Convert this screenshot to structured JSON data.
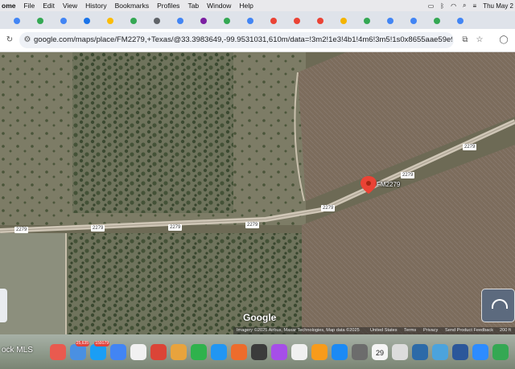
{
  "menubar": {
    "app_name": "ome",
    "items": [
      "File",
      "Edit",
      "View",
      "History",
      "Bookmarks",
      "Profiles",
      "Tab",
      "Window",
      "Help"
    ],
    "clock": "Thu May 2"
  },
  "tabs": {
    "favicon_colors": [
      "#4285f4",
      "#34a853",
      "#4285f4",
      "#1a73e8",
      "#fbbc05",
      "#34a853",
      "#5f6368",
      "#4285f4",
      "#7b1fa2",
      "#34a853",
      "#4285f4",
      "#ea4335",
      "#ea4335",
      "#ea4335",
      "#f4b400",
      "#34a853",
      "#4285f4",
      "#4285f4",
      "#34a853",
      "#4285f4"
    ]
  },
  "toolbar": {
    "url": "google.com/maps/place/FM2279,+Texas/@33.3983649,-99.9531031,610m/data=!3m2!1e3!4b1!4m6!3m5!1s0x8655aae59e925437:0x..."
  },
  "map": {
    "pin_label": "FM2279",
    "road_labels": [
      "2279",
      "2279",
      "2279",
      "2279",
      "2279",
      "2279",
      "2279"
    ],
    "logo": "Google",
    "attribution": {
      "imagery": "Imagery ©2025 Airbus, Maxar Technologies, Map data ©2025",
      "country": "United States",
      "terms": "Terms",
      "privacy": "Privacy",
      "feedback": "Send Product Feedback",
      "scale": "200 ft"
    }
  },
  "dock": {
    "bg_text": "ock MLS",
    "mail_badge": "25,635",
    "mail2_badge": "159179",
    "calendar_day": "29",
    "calendar_month": "MAY",
    "app_colors": [
      "#e95a4f",
      "#4a90e2",
      "#1a9ef5",
      "#4285f4",
      "#f1f1f1",
      "#db4437",
      "#e8a33d",
      "#2fb24c",
      "#2196f3",
      "#ed6c2c",
      "#3b3b3b",
      "#a64ee8",
      "#f0f0f0",
      "#f89b1b",
      "#1b8af5",
      "#6c6c6c",
      "#f5f5f5",
      "#dcdcdc",
      "#2c6aa8",
      "#4ca3dd",
      "#2b579a",
      "#2d8cff",
      "#34a853"
    ]
  }
}
